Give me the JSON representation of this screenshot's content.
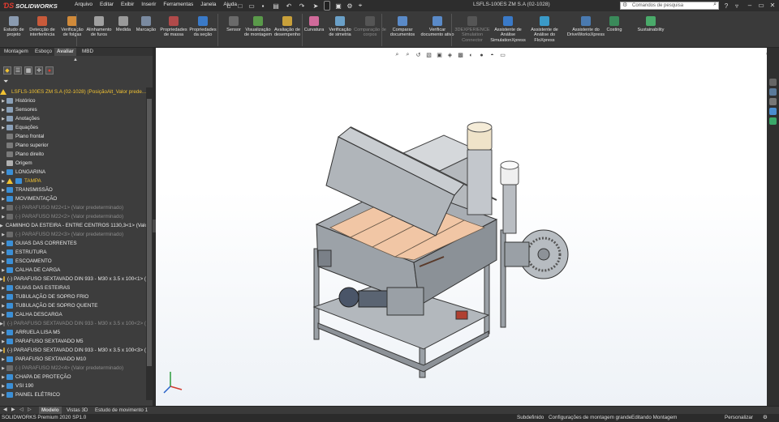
{
  "app": {
    "logo": "SOLIDWORKS",
    "document_title": "LSFLS-100ES ZM S.A (02-1028)"
  },
  "menu": [
    "Arquivo",
    "Editar",
    "Exibir",
    "Inserir",
    "Ferramentas",
    "Janela",
    "Ajuda"
  ],
  "search": {
    "placeholder": "Comandos de pesquisa"
  },
  "commands": [
    {
      "label": "Estudo de projeto",
      "disabled": false
    },
    {
      "label": "Detecção de interferência",
      "disabled": false
    },
    {
      "label": "Verificação de folgas",
      "disabled": false
    },
    {
      "label": "Alinhamento de furos",
      "disabled": false
    },
    {
      "label": "Medida",
      "disabled": false
    },
    {
      "label": "Marcação",
      "disabled": false
    },
    {
      "label": "Propriedades de massa",
      "disabled": false
    },
    {
      "label": "Propriedades da seção",
      "disabled": false
    },
    {
      "label": "Sensor",
      "disabled": false
    },
    {
      "label": "Visualização de montagem",
      "disabled": false
    },
    {
      "label": "Avaliação de desempenho",
      "disabled": false
    },
    {
      "label": "Curvatura",
      "disabled": false
    },
    {
      "label": "Verificação de simetria",
      "disabled": false
    },
    {
      "label": "Comparação de corpos",
      "disabled": true
    },
    {
      "label": "Comparar documentos",
      "disabled": false
    },
    {
      "label": "Verificar documento ativo",
      "disabled": false
    },
    {
      "label": "3DEXPERIENCE Simulation Connector",
      "disabled": true
    },
    {
      "label": "Assistente de Análise SimulationXpress",
      "disabled": false
    },
    {
      "label": "Assistente de Análise do FloXpress",
      "disabled": false
    },
    {
      "label": "Assistente do DriveWorksXpress",
      "disabled": false
    },
    {
      "label": "Costing",
      "disabled": false
    },
    {
      "label": "Sustainability",
      "disabled": false
    }
  ],
  "left_tabs": [
    "Montagem",
    "Esboço",
    "Avaliar",
    "MBD"
  ],
  "active_left_tab": "Avaliar",
  "tree": [
    {
      "label": "LSFLS-100ES ZM S.A (02-1028)  (PosiçãoAlt_Valor prede...",
      "kind": "root"
    },
    {
      "label": "Histórico",
      "kind": "item"
    },
    {
      "label": "Sensores",
      "kind": "item"
    },
    {
      "label": "Anotações",
      "kind": "item"
    },
    {
      "label": "Equações",
      "kind": "item"
    },
    {
      "label": "Plano frontal",
      "kind": "plane"
    },
    {
      "label": "Plano superior",
      "kind": "plane"
    },
    {
      "label": "Plano direito",
      "kind": "plane"
    },
    {
      "label": "Origem",
      "kind": "origin"
    },
    {
      "label": "LONGARINA",
      "kind": "folder"
    },
    {
      "label": "TAMPA",
      "kind": "warn"
    },
    {
      "label": "TRANSMISSÃO",
      "kind": "folder"
    },
    {
      "label": "MOVIMENTAÇÃO",
      "kind": "folder"
    },
    {
      "label": "(-) PARAFUSO M22<1> (Valor predeterminado)",
      "kind": "dim"
    },
    {
      "label": "(-) PARAFUSO M22<2> (Valor predeterminado)",
      "kind": "dim"
    },
    {
      "label": "CAMINHO DA ESTEIRA - ENTRE CENTROS 1130,3<1> (Valo",
      "kind": "folder"
    },
    {
      "label": "(-) PARAFUSO M22<3> (Valor predeterminado)",
      "kind": "dim"
    },
    {
      "label": "GUIAS DAS CORRENTES",
      "kind": "folder"
    },
    {
      "label": "ESTRUTURA",
      "kind": "folder"
    },
    {
      "label": "ESCOAMENTO",
      "kind": "folder"
    },
    {
      "label": "CALHA DE CARGA",
      "kind": "folder"
    },
    {
      "label": "(-) PARAFUSO SEXTAVADO DIN 933 - M30 x 3.5 x 100<1> (",
      "kind": "part"
    },
    {
      "label": "GUIAS DAS ESTEIRAS",
      "kind": "folder"
    },
    {
      "label": "TUBULAÇÃO DE SOPRO FRIO",
      "kind": "folder"
    },
    {
      "label": "TUBULAÇÃO DE SOPRO QUENTE",
      "kind": "folder"
    },
    {
      "label": "CALHA DESCARGA",
      "kind": "folder"
    },
    {
      "label": "(-) PARAFUSO SEXTAVADO DIN 933 - M30 x 3.5 x 100<2> (",
      "kind": "dim"
    },
    {
      "label": "ARRUELA LISA M5",
      "kind": "folder"
    },
    {
      "label": "PARAFUSO SEXTAVADO M5",
      "kind": "folder"
    },
    {
      "label": "(-) PARAFUSO SEXTAVADO DIN 933 - M30 x 3.5 x 100<3> (",
      "kind": "part"
    },
    {
      "label": "PARAFUSO SEXTAVADO M10",
      "kind": "folder"
    },
    {
      "label": "(-) PARAFUSO M22<4> (Valor predeterminado)",
      "kind": "dim"
    },
    {
      "label": "CHAPA DE PROTEÇÃO",
      "kind": "folder"
    },
    {
      "label": "VSI 190",
      "kind": "folder"
    },
    {
      "label": "PAINEL ELÉTRICO",
      "kind": "folder"
    }
  ],
  "bottom_tabs": [
    "Modelo",
    "Vistas 3D",
    "Estudo de movimento 1"
  ],
  "status": {
    "product": "SOLIDWORKS Premium 2020 SP1.0",
    "state": "Subdefinido",
    "config": "Configurações de montagem grande",
    "mode": "Editando Montagem",
    "customize": "Personalizar"
  },
  "colors": {
    "accent": "#e23b30",
    "folder": "#3b8fd6",
    "warning": "#f1c232"
  }
}
